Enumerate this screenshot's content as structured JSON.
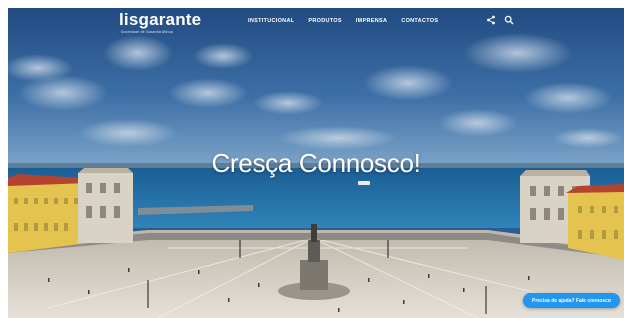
{
  "header": {
    "logo_text": "lisgarante",
    "logo_tagline": "Sociedade de Garantia Mútua",
    "nav": [
      {
        "label": "INSTITUCIONAL"
      },
      {
        "label": "PRODUTOS"
      },
      {
        "label": "IMPRENSA"
      },
      {
        "label": "CONTACTOS"
      }
    ],
    "icons": [
      "share-icon",
      "search-icon"
    ]
  },
  "hero": {
    "title": "Cresça Connosco!"
  },
  "help_button": {
    "label": "Precisa de ajuda? Fale connosco"
  },
  "colors": {
    "sky_top": "#244f86",
    "sky_bottom": "#5b8dbd",
    "river": "#1f6fa8",
    "plaza": "#d6cfc3",
    "building_yellow": "#e3c04a",
    "roof_red": "#b4432f",
    "accent_blue": "#2196f3"
  }
}
